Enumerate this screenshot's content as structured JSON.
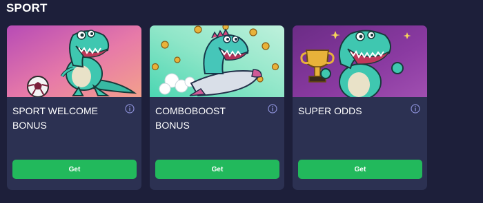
{
  "section": {
    "title": "SPORT"
  },
  "cards": [
    {
      "title_line1": "SPORT WELCOME",
      "title_line2": "BONUS",
      "button_label": "Get"
    },
    {
      "title_line1": "COMBOBOOST",
      "title_line2": "BONUS",
      "button_label": "Get"
    },
    {
      "title_line1": "SUPER ODDS",
      "title_line2": "",
      "button_label": "Get"
    }
  ],
  "colors": {
    "background": "#1d1f3a",
    "card": "#2c3152",
    "button": "#22b95c",
    "info_icon": "#8b8fd6",
    "dino": "#3fc7b0"
  },
  "icons": {
    "info": "info-circle-icon"
  }
}
